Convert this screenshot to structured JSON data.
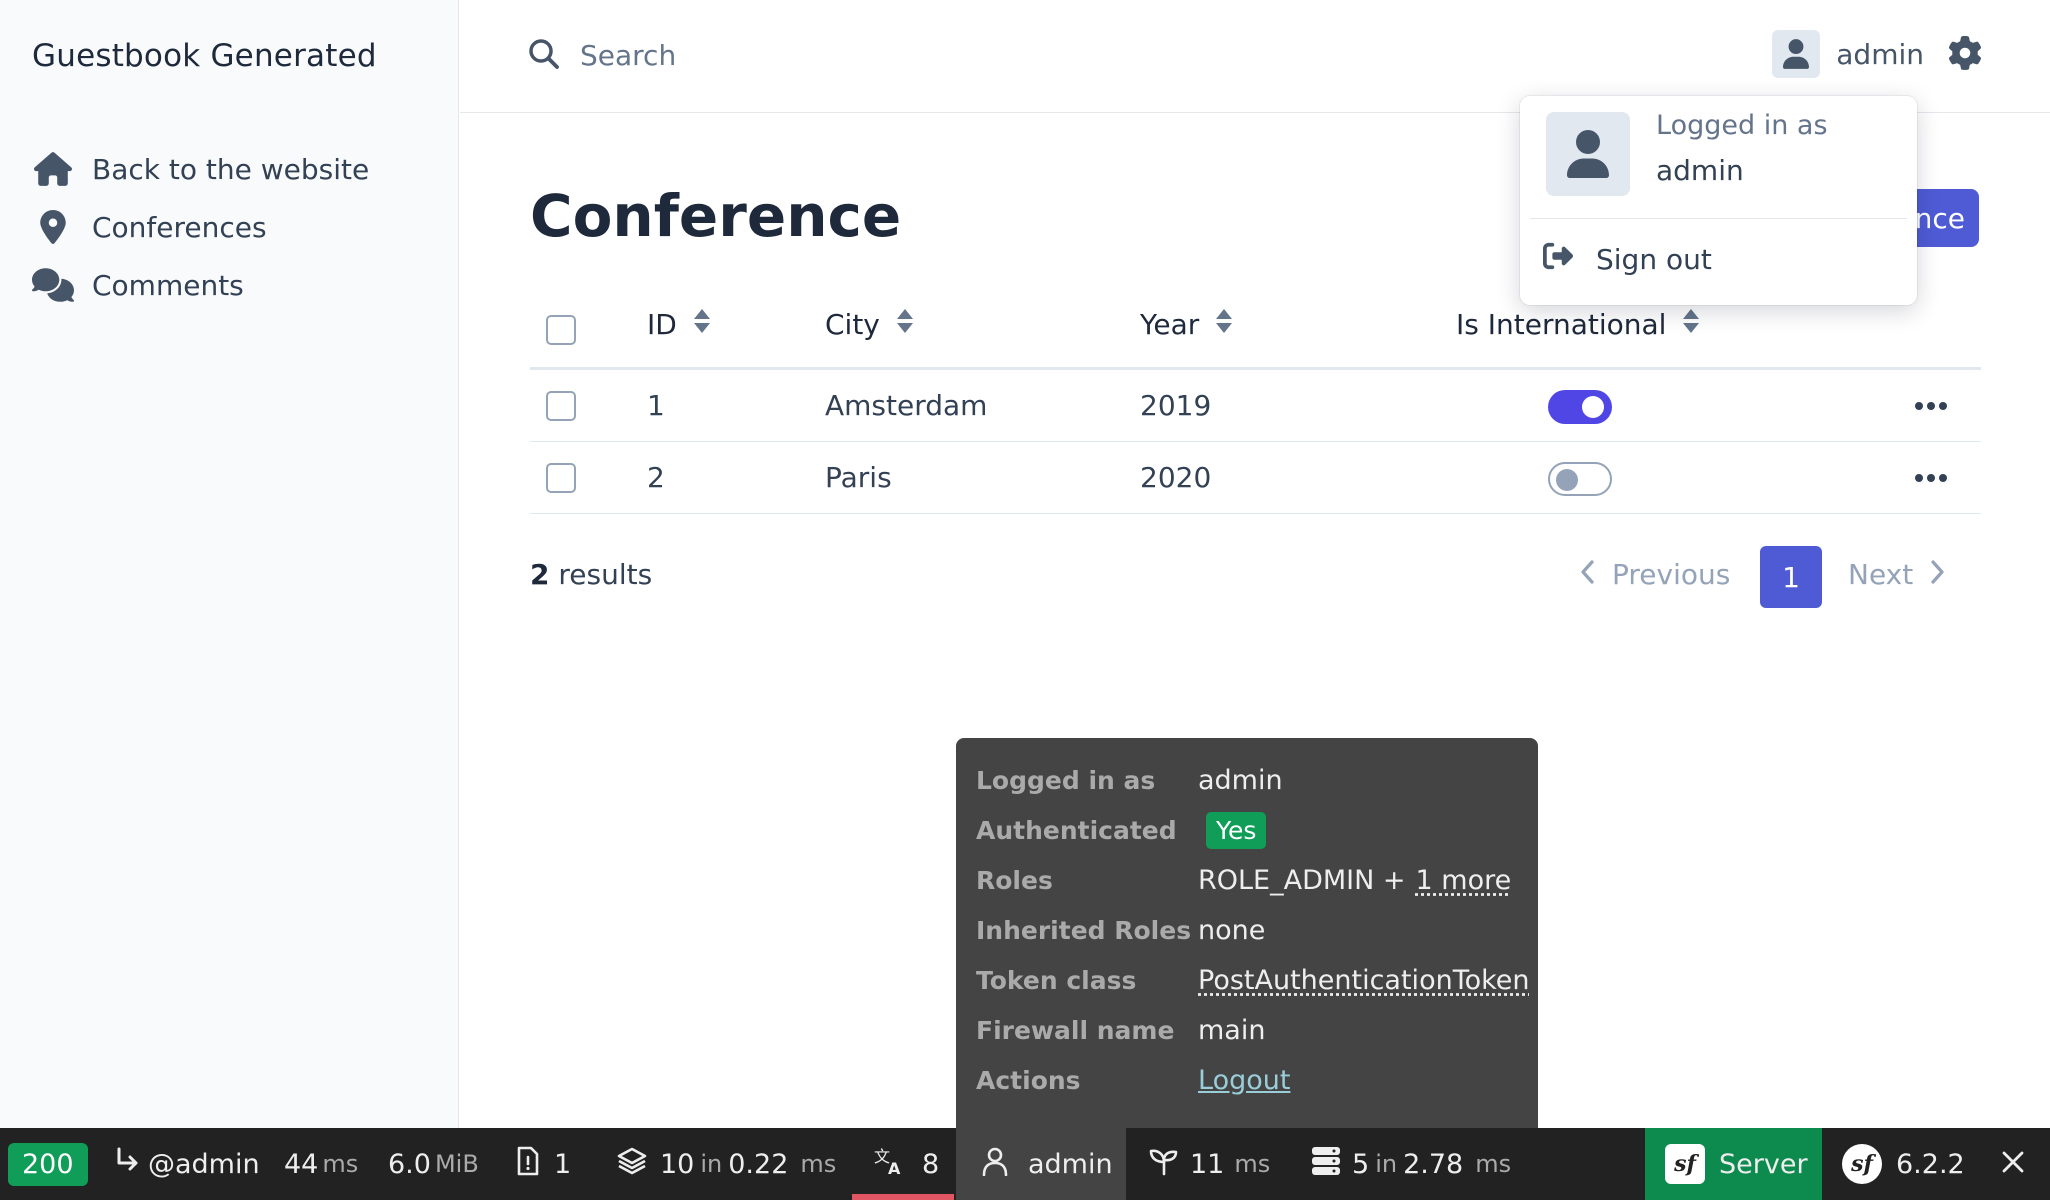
{
  "app": {
    "title": "Guestbook Generated"
  },
  "sidebar": {
    "items": [
      {
        "label": "Back to the website",
        "icon": "home-icon"
      },
      {
        "label": "Conferences",
        "icon": "map-marker-icon"
      },
      {
        "label": "Comments",
        "icon": "comments-icon"
      }
    ]
  },
  "header": {
    "search_placeholder": "Search",
    "username": "admin"
  },
  "user_dropdown": {
    "logged_in_label": "Logged in as",
    "username": "admin",
    "sign_out": "Sign out"
  },
  "main": {
    "title": "Conference",
    "add_button_visible_text": "nce",
    "columns": [
      "ID",
      "City",
      "Year",
      "Is International"
    ],
    "rows": [
      {
        "id": "1",
        "city": "Amsterdam",
        "year": "2019",
        "is_international": true
      },
      {
        "id": "2",
        "city": "Paris",
        "year": "2020",
        "is_international": false
      }
    ],
    "results_count": "2",
    "results_label": "results",
    "pagination": {
      "previous": "Previous",
      "current_page": "1",
      "next": "Next"
    }
  },
  "profiler_toolbar": {
    "status_code": "200",
    "route": "@admin",
    "time_value": "44",
    "time_unit": "ms",
    "memory_value": "6.0",
    "memory_unit": "MiB",
    "logs_count": "1",
    "cache_calls": "10",
    "cache_in": "in",
    "cache_time": "0.22",
    "cache_unit": "ms",
    "translations_count": "8",
    "user": "admin",
    "twig_time": "11",
    "twig_unit": "ms",
    "db_queries": "5",
    "db_in": "in",
    "db_time": "2.78",
    "db_unit": "ms",
    "server_label": "Server",
    "symfony_version": "6.2.2",
    "colors": {
      "bar": "#222222",
      "status_ok": "#0f9d58",
      "server": "#0d8a4e",
      "active_underline": "#e25563"
    }
  },
  "security_panel": {
    "rows": [
      {
        "key": "Logged in as",
        "value": "admin"
      },
      {
        "key": "Authenticated",
        "value": "Yes"
      },
      {
        "key": "Roles",
        "value": "ROLE_ADMIN +",
        "extra": "1 more"
      },
      {
        "key": "Inherited Roles",
        "value": "none"
      },
      {
        "key": "Token class",
        "value": "PostAuthenticationToken"
      },
      {
        "key": "Firewall name",
        "value": "main"
      },
      {
        "key": "Actions",
        "value": "Logout"
      }
    ]
  },
  "colors": {
    "accent": "#4f5bd5",
    "toggle_on": "#4f46e5",
    "sidebar_bg": "#f8fafc"
  }
}
